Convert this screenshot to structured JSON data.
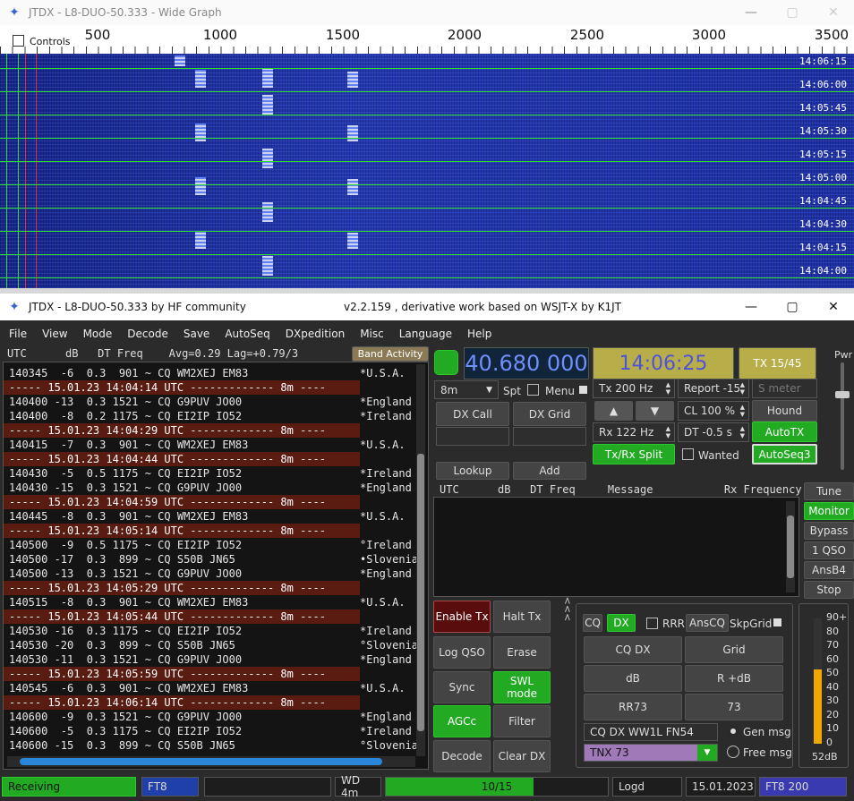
{
  "wide": {
    "title": "JTDX - L8-DUO-50.333 - Wide Graph",
    "controls": "Controls",
    "ticks": [
      "500",
      "1000",
      "1500",
      "2000",
      "2500",
      "3000",
      "3500"
    ],
    "times": [
      "14:06:15",
      "14:06:00",
      "14:05:45",
      "14:05:30",
      "14:05:15",
      "14:05:00",
      "14:04:45",
      "14:04:30",
      "14:04:15",
      "14:04:00"
    ]
  },
  "main": {
    "title": "JTDX - L8-DUO-50.333  by HF community",
    "version": "v2.2.159 , derivative work based on WSJT-X by K1JT"
  },
  "menu": [
    "File",
    "View",
    "Mode",
    "Decode",
    "Save",
    "AutoSeq",
    "DXpedition",
    "Misc",
    "Language",
    "Help"
  ],
  "band_header": "UTC      dB   DT Freq    Avg=0.29 Lag=+0.79/3",
  "band_activity": "Band Activity",
  "decodes": [
    {
      "t": "140345  -6  0.3  901 ~ CQ WM2XEJ EM83",
      "c": "*U.S.A."
    },
    {
      "sep": "----- 15.01.23 14:04:14 UTC ------------- 8m ----"
    },
    {
      "t": "140400 -13  0.3 1521 ~ CQ G9PUV JO00",
      "c": "*England"
    },
    {
      "t": "140400  -8  0.2 1175 ~ CQ EI2IP IO52",
      "c": "*Ireland"
    },
    {
      "sep": "----- 15.01.23 14:04:29 UTC ------------- 8m ----"
    },
    {
      "t": "140415  -7  0.3  901 ~ CQ WM2XEJ EM83",
      "c": "*U.S.A."
    },
    {
      "sep": "----- 15.01.23 14:04:44 UTC ------------- 8m ----"
    },
    {
      "t": "140430  -5  0.5 1175 ~ CQ EI2IP IO52",
      "c": "*Ireland"
    },
    {
      "t": "140430 -15  0.3 1521 ~ CQ G9PUV JO00",
      "c": "*England"
    },
    {
      "sep": "----- 15.01.23 14:04:59 UTC ------------- 8m ----"
    },
    {
      "t": "140445  -8  0.3  901 ~ CQ WM2XEJ EM83",
      "c": "*U.S.A."
    },
    {
      "sep": "----- 15.01.23 14:05:14 UTC ------------- 8m ----"
    },
    {
      "t": "140500  -9  0.5 1175 ~ CQ EI2IP IO52",
      "c": "°Ireland"
    },
    {
      "t": "140500 -17  0.3  899 ~ CQ S50B JN65",
      "c": "•Slovenia"
    },
    {
      "t": "140500 -13  0.3 1521 ~ CQ G9PUV JO00",
      "c": "*England"
    },
    {
      "sep": "----- 15.01.23 14:05:29 UTC ------------- 8m ----"
    },
    {
      "t": "140515  -8  0.3  901 ~ CQ WM2XEJ EM83",
      "c": "*U.S.A."
    },
    {
      "sep": "----- 15.01.23 14:05:44 UTC ------------- 8m ----"
    },
    {
      "t": "140530 -16  0.3 1175 ~ CQ EI2IP IO52",
      "c": "*Ireland"
    },
    {
      "t": "140530 -20  0.3  899 ~ CQ S50B JN65",
      "c": "°Slovenia"
    },
    {
      "t": "140530 -11  0.3 1521 ~ CQ G9PUV JO00",
      "c": "*England"
    },
    {
      "sep": "----- 15.01.23 14:05:59 UTC ------------- 8m ----"
    },
    {
      "t": "140545  -6  0.3  901 ~ CQ WM2XEJ EM83",
      "c": "*U.S.A."
    },
    {
      "sep": "----- 15.01.23 14:06:14 UTC ------------- 8m ----"
    },
    {
      "t": "140600  -9  0.3 1521 ~ CQ G9PUV JO00",
      "c": "*England"
    },
    {
      "t": "140600  -5  0.3 1175 ~ CQ EI2IP IO52",
      "c": "*Ireland"
    },
    {
      "t": "140600 -15  0.3  899 ~ CQ S50B JN65",
      "c": "°Slovenia"
    }
  ],
  "freq": "40.680 000",
  "clock": "14:06:25",
  "tx_period": "TX 15/45",
  "band": "8m",
  "spt": "Spt",
  "menu_chk": "Menu",
  "tx_hz": "Tx  200  Hz",
  "rx_hz": "Rx  122  Hz",
  "report": "Report -15",
  "smeter": "S meter",
  "cl": "CL  100 %",
  "dt": "DT -0.5 s",
  "hound": "Hound",
  "autotx": "AutoTX",
  "autoseq": "AutoSeq3",
  "split": "Tx/Rx Split",
  "wanted": "Wanted",
  "dxcall": "DX Call",
  "dxgrid": "DX Grid",
  "lookup": "Lookup",
  "add": "Add",
  "rx_header": "UTC      dB   DT Freq     Message           Rx Frequency",
  "side": [
    "Tune",
    "Monitor",
    "Bypass",
    "1 QSO",
    "AnsB4",
    "Stop"
  ],
  "left_btns": [
    "Enable Tx",
    "Halt Tx",
    "Log QSO",
    "Erase",
    "Sync",
    "SWL mode",
    "AGCc",
    "Filter",
    "Decode",
    "Clear DX"
  ],
  "seq": {
    "cq": "CQ",
    "dx": "DX",
    "rrr": "RRR",
    "anscq": "AnsCQ",
    "skipgrid": "SkpGrid",
    "cqdx": "CQ DX",
    "grid": "Grid",
    "db": "dB",
    "rdb": "R +dB",
    "rr73": "RR73",
    "s73": "73",
    "genmsg_text": "CQ DX WW1L FN54",
    "tnx": "TNX 73",
    "gen": "Gen msg",
    "free": "Free msg"
  },
  "pwr": "Pwr",
  "meter": {
    "labels": [
      "90+",
      "80",
      "70",
      "60",
      "50",
      "40",
      "30",
      "20",
      "10",
      "0"
    ],
    "db": "52dB",
    "level": 0.52
  },
  "status": {
    "state": "Receiving",
    "mode": "FT8",
    "wd": "WD 4m",
    "progress": "10/15",
    "progress_frac": 0.667,
    "log": "Logd",
    "date": "15.01.2023",
    "mode2": "FT8  200"
  },
  "colors": {
    "accent": "#22aa22",
    "freq": "#7b8cff",
    "clock": "#5a5ae0"
  }
}
